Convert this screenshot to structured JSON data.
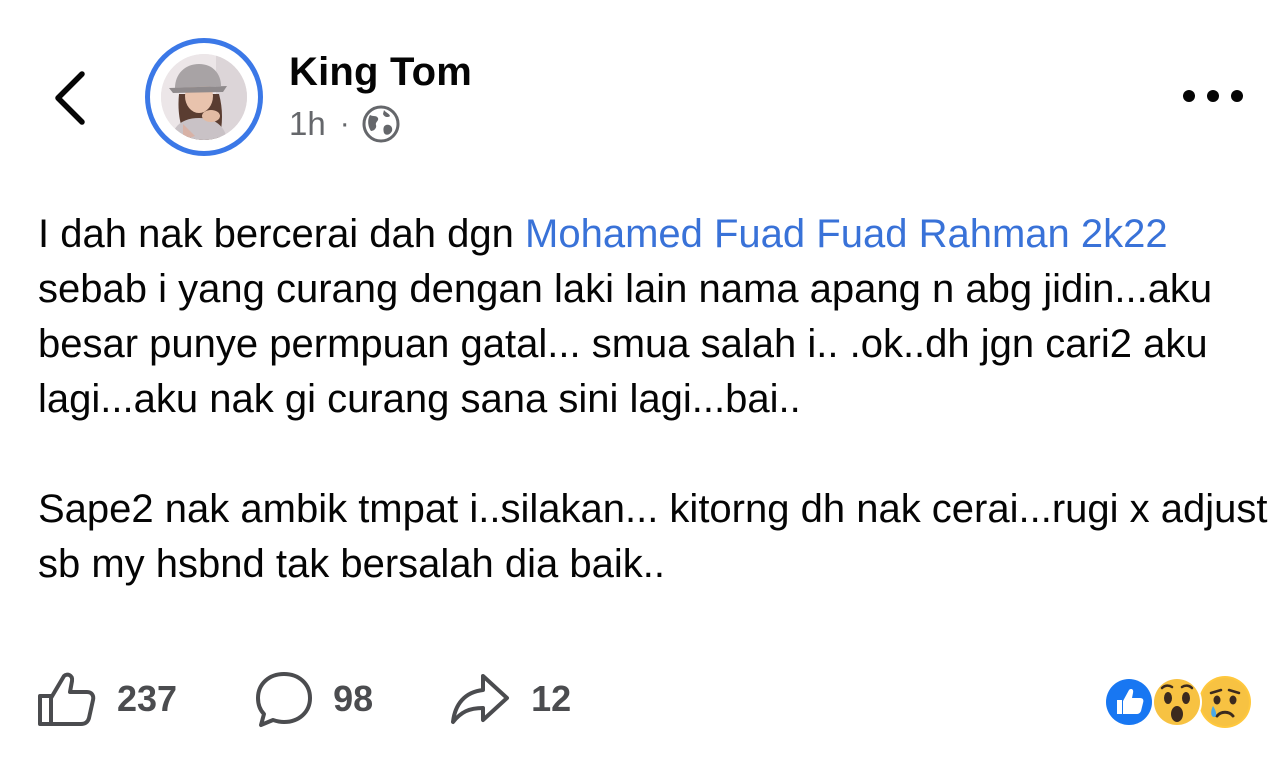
{
  "header": {
    "author_name": "King Tom",
    "timestamp": "1h",
    "separator": "·",
    "privacy_icon": "globe-icon",
    "back_icon": "chevron-left-icon",
    "more_icon": "ellipsis-icon"
  },
  "post": {
    "line_prefix": "I dah nak bercerai dah dgn ",
    "mention": "Mohamed Fuad Fuad Rahman 2k22",
    "paragraph1_rest": "  sebab i yang curang dengan laki lain nama apang n abg jidin...aku besar punye permpuan gatal... smua salah i.. .ok..dh jgn cari2 aku lagi...aku nak gi curang sana sini lagi...bai..",
    "paragraph2": "Sape2 nak ambik tmpat i..silakan... kitorng dh nak cerai...rugi x adjust sb my hsbnd tak bersalah dia baik.."
  },
  "actions": {
    "likes": "237",
    "comments": "98",
    "shares": "12"
  },
  "reactions": [
    "like",
    "wow",
    "sad"
  ],
  "colors": {
    "accent": "#3b78e7",
    "mention": "#3972d8",
    "muted": "#65676b"
  }
}
